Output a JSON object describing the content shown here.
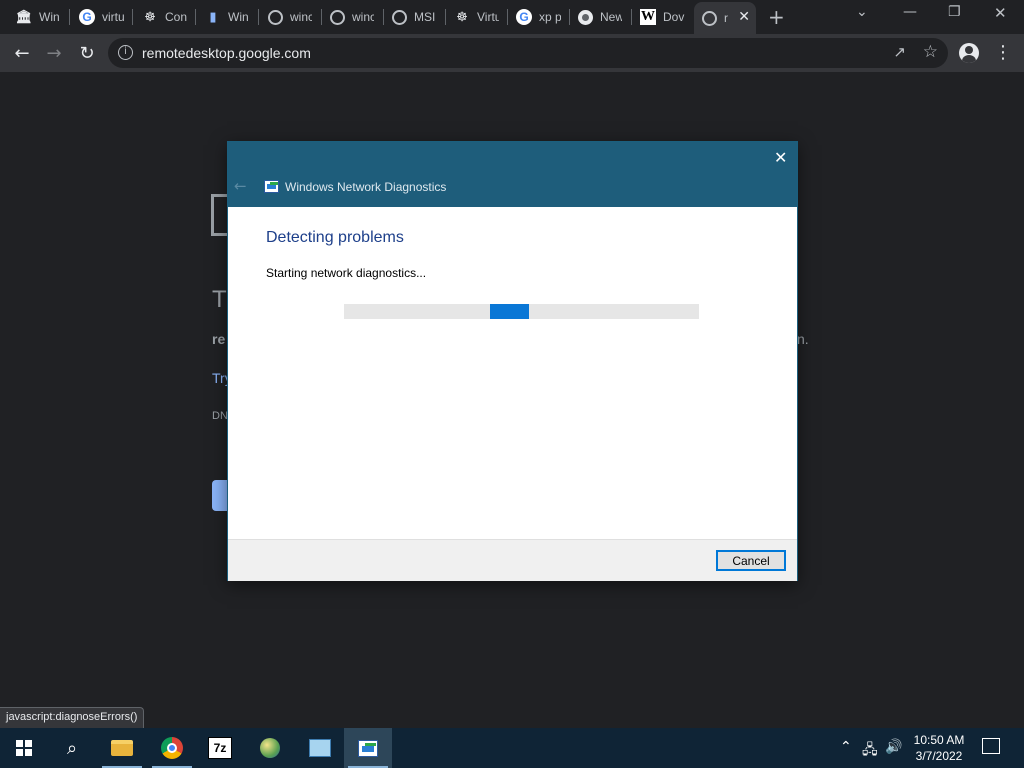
{
  "browser": {
    "tabs": [
      {
        "label": "Win",
        "icon": "museum-icon"
      },
      {
        "label": "virtu",
        "icon": "google-icon"
      },
      {
        "label": "Con",
        "icon": "ship-wheel-icon"
      },
      {
        "label": "Win",
        "icon": "bookmark-icon"
      },
      {
        "label": "winc",
        "icon": "globe-icon"
      },
      {
        "label": "winc",
        "icon": "globe-icon"
      },
      {
        "label": "MSI",
        "icon": "globe-icon"
      },
      {
        "label": "Virtu",
        "icon": "ship-wheel-icon"
      },
      {
        "label": "xp p",
        "icon": "google-icon"
      },
      {
        "label": "New",
        "icon": "chrome-icon"
      },
      {
        "label": "Dov",
        "icon": "wikipedia-icon"
      },
      {
        "label": "r",
        "icon": "globe-icon",
        "active": true
      }
    ],
    "url": "remotedesktop.google.com",
    "status_url": "javascript:diagnoseErrors()"
  },
  "background_page": {
    "title_fragment": "T",
    "bold_fragment": "re",
    "tail_fragment": "n.",
    "link_fragment": "Try",
    "code_fragment": "DN"
  },
  "dialog": {
    "title": "Windows Network Diagnostics",
    "heading": "Detecting problems",
    "status": "Starting network diagnostics...",
    "progress": {
      "start": 0.41,
      "end": 0.52
    },
    "cancel_label": "Cancel"
  },
  "taskbar": {
    "time": "10:50 AM",
    "date": "3/7/2022"
  }
}
